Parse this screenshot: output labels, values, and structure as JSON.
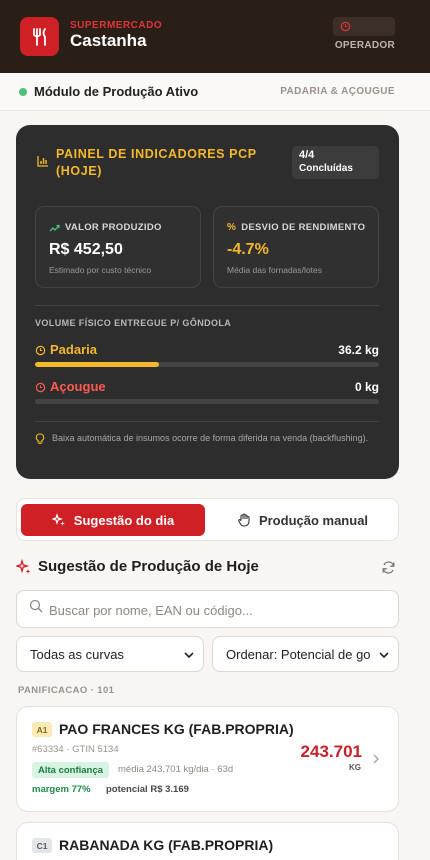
{
  "header": {
    "brand_small": "SUPERMERCADO",
    "brand_name": "Castanha",
    "user_role": "OPERADOR"
  },
  "module": {
    "status": "Módulo de Produção Ativo",
    "sectors": "PADARIA & AÇOUGUE"
  },
  "dashboard": {
    "title": "PAINEL DE INDICADORES PCP (HOJE)",
    "done_count": "4/4",
    "done_label": "Concluídas",
    "kpi_value": {
      "label": "VALOR PRODUZIDO",
      "value": "R$ 452,50",
      "sub": "Estimado por custo técnico"
    },
    "kpi_deviation": {
      "label": "DESVIO DE RENDIMENTO",
      "value": "-4.7%",
      "sub": "Média das fornadas/lotes"
    },
    "volume_label": "VOLUME FÍSICO ENTREGUE P/ GÔNDOLA",
    "rows": [
      {
        "name": "Padaria",
        "value": "36.2 kg",
        "fraction": 0.36
      },
      {
        "name": "Açougue",
        "value": "0 kg",
        "fraction": 0
      }
    ],
    "note": "Baixa automática de insumos ocorre de forma diferida na venda (backflushing)."
  },
  "tabs": {
    "suggestion": "Sugestão do dia",
    "manual": "Produção manual"
  },
  "suggestions": {
    "title": "Sugestão de Produção de Hoje",
    "search_placeholder": "Buscar por nome, EAN ou código...",
    "filter_curve": "Todas as curvas",
    "sort": "Ordenar: Potencial de go",
    "group": "PANIFICACAO · 101"
  },
  "products": [
    {
      "curve": "A1",
      "name": "PAO FRANCES KG (FAB.PROPRIA)",
      "meta": "#63334 · GTIN 5134",
      "confidence": "Alta confiança",
      "avg": "média 243.701 kg/dia · 63d",
      "margin": "margem 77%",
      "potential": "potencial R$ 3.169",
      "qty": "243.701",
      "unit": "KG"
    },
    {
      "curve": "C1",
      "name": "RABANADA KG (FAB.PROPRIA)"
    }
  ],
  "colors": {
    "header_bg": "#2a1f17",
    "brand_red": "#cf2026",
    "accent_yellow": "#f5b82a",
    "negative_red": "#ff5a4f",
    "success_green": "#1d8a4a",
    "active_dot": "#4ec07a"
  },
  "icons": {
    "logo": "fork-knife-icon",
    "user": "clock-icon",
    "dashboard": "bar-chart-icon",
    "trend": "trending-up-icon",
    "percent": "percent-icon",
    "bakery": "clock-icon",
    "butcher": "clock-icon",
    "note": "lightbulb-icon",
    "sparkle": "sparkles-icon",
    "hand": "hand-icon",
    "refresh": "refresh-icon",
    "search": "search-icon",
    "chevron": "chevron-down-icon",
    "card_chevron": "chevron-right-icon"
  }
}
